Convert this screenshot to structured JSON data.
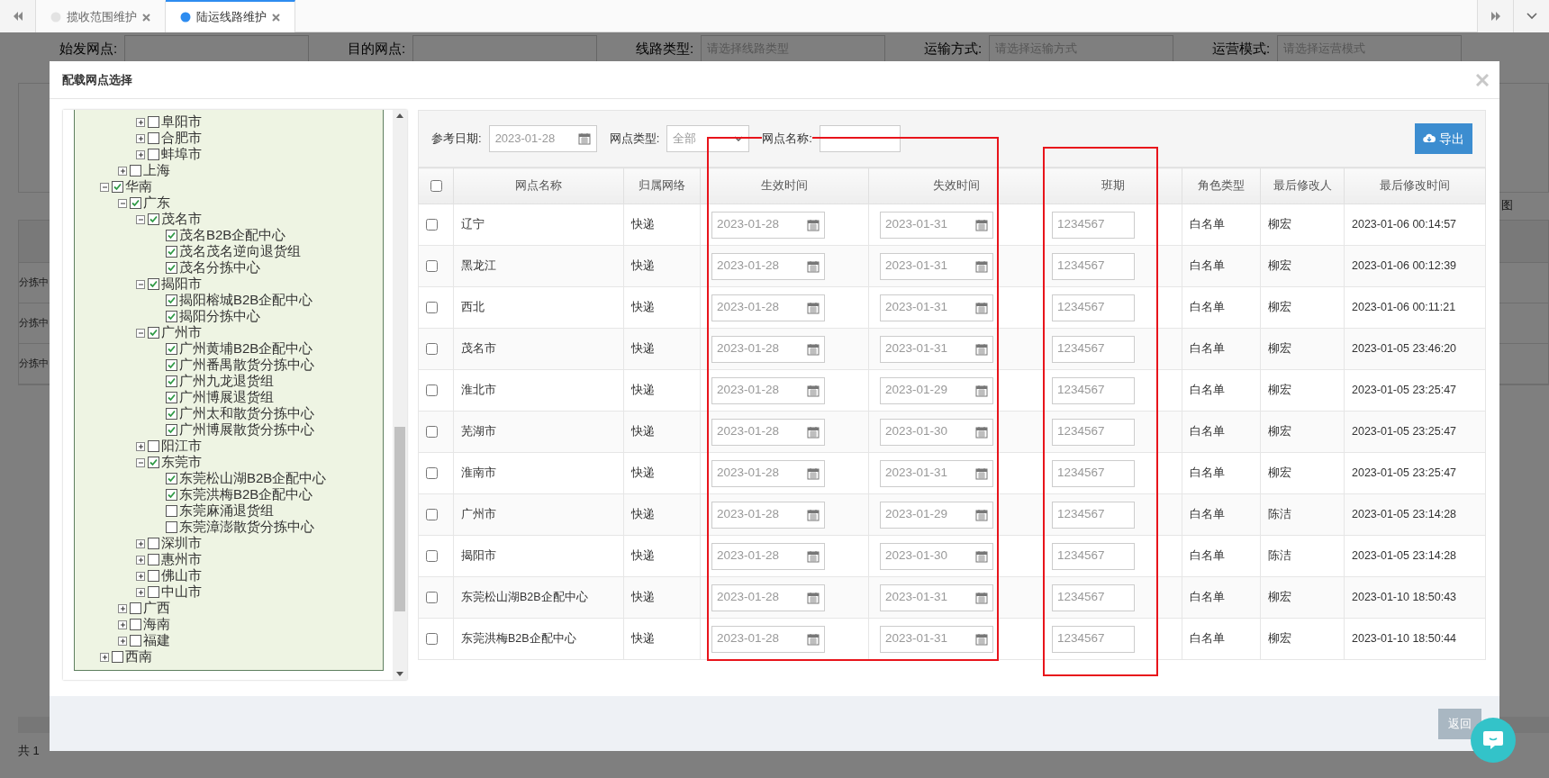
{
  "tabs": [
    {
      "label": "揽收范围维护",
      "selected": false
    },
    {
      "label": "陆运线路维护",
      "selected": true
    }
  ],
  "background": {
    "filters": [
      {
        "label": "始发网点:"
      },
      {
        "label": "目的网点:"
      },
      {
        "label": "线路类型:",
        "placeholder": "请选择线路类型"
      },
      {
        "label": "运输方式:",
        "placeholder": "请选择运输方式"
      },
      {
        "label": "运营模式:",
        "placeholder": "请选择运营模式"
      }
    ],
    "cells": [
      "分拣中",
      "分拣中",
      "分拣中"
    ],
    "side_text": "图",
    "pager": "共 1"
  },
  "dialog": {
    "title": "配载网点选择",
    "tree": [
      {
        "children": [
          {
            "children": [
              {
                "label": "阜阳市",
                "checked": false,
                "expanded": false
              },
              {
                "label": "合肥市",
                "checked": false,
                "expanded": false
              },
              {
                "label": "蚌埠市",
                "checked": false,
                "expanded": false
              }
            ]
          },
          {
            "label": "上海",
            "checked": false,
            "expanded": false
          }
        ]
      },
      {
        "label": "华南",
        "checked": true,
        "expanded": true,
        "children": [
          {
            "label": "广东",
            "checked": true,
            "expanded": true,
            "children": [
              {
                "label": "茂名市",
                "checked": true,
                "expanded": true,
                "children": [
                  {
                    "label": "茂名B2B企配中心",
                    "checked": true
                  },
                  {
                    "label": "茂名茂名逆向退货组",
                    "checked": true
                  },
                  {
                    "label": "茂名分拣中心",
                    "checked": true
                  }
                ]
              },
              {
                "label": "揭阳市",
                "checked": true,
                "expanded": true,
                "children": [
                  {
                    "label": "揭阳榕城B2B企配中心",
                    "checked": true
                  },
                  {
                    "label": "揭阳分拣中心",
                    "checked": true
                  }
                ]
              },
              {
                "label": "广州市",
                "checked": true,
                "expanded": true,
                "children": [
                  {
                    "label": "广州黄埔B2B企配中心",
                    "checked": true
                  },
                  {
                    "label": "广州番禺散货分拣中心",
                    "checked": true
                  },
                  {
                    "label": "广州九龙退货组",
                    "checked": true
                  },
                  {
                    "label": "广州博展退货组",
                    "checked": true
                  },
                  {
                    "label": "广州太和散货分拣中心",
                    "checked": true
                  },
                  {
                    "label": "广州博展散货分拣中心",
                    "checked": true
                  }
                ]
              },
              {
                "label": "阳江市",
                "checked": false,
                "expanded": false
              },
              {
                "label": "东莞市",
                "checked": true,
                "expanded": true,
                "children": [
                  {
                    "label": "东莞松山湖B2B企配中心",
                    "checked": true
                  },
                  {
                    "label": "东莞洪梅B2B企配中心",
                    "checked": true
                  },
                  {
                    "label": "东莞麻涌退货组",
                    "checked": false
                  },
                  {
                    "label": "东莞漳澎散货分拣中心",
                    "checked": false
                  }
                ]
              },
              {
                "label": "深圳市",
                "checked": false,
                "expanded": false
              },
              {
                "label": "惠州市",
                "checked": false,
                "expanded": false
              },
              {
                "label": "佛山市",
                "checked": false,
                "expanded": false
              },
              {
                "label": "中山市",
                "checked": false,
                "expanded": false
              }
            ]
          },
          {
            "label": "广西",
            "checked": false,
            "expanded": false
          },
          {
            "label": "海南",
            "checked": false,
            "expanded": false
          },
          {
            "label": "福建",
            "checked": false,
            "expanded": false
          }
        ]
      },
      {
        "label": "西南",
        "checked": false,
        "expanded": false
      }
    ],
    "filters": {
      "date_label": "参考日期:",
      "date": "2023-01-28",
      "type_label": "网点类型:",
      "type": "全部",
      "name_label": "网点名称:",
      "export": "导出"
    },
    "columns": [
      "网点名称",
      "归属网络",
      "生效时间",
      "失效时间",
      "班期",
      "角色类型",
      "最后修改人",
      "最后修改时间"
    ],
    "all_checked": false,
    "rows": [
      {
        "checked": false,
        "name": "辽宁",
        "network": "快递",
        "start": "2023-01-28",
        "end": "2023-01-31",
        "schedule": "1234567",
        "role": "白名单",
        "modifier": "柳宏",
        "modified": "2023-01-06 00:14:57"
      },
      {
        "checked": false,
        "name": "黑龙江",
        "network": "快递",
        "start": "2023-01-28",
        "end": "2023-01-31",
        "schedule": "1234567",
        "role": "白名单",
        "modifier": "柳宏",
        "modified": "2023-01-06 00:12:39"
      },
      {
        "checked": false,
        "name": "西北",
        "network": "快递",
        "start": "2023-01-28",
        "end": "2023-01-31",
        "schedule": "1234567",
        "role": "白名单",
        "modifier": "柳宏",
        "modified": "2023-01-06 00:11:21"
      },
      {
        "checked": false,
        "name": "茂名市",
        "network": "快递",
        "start": "2023-01-28",
        "end": "2023-01-31",
        "schedule": "1234567",
        "role": "白名单",
        "modifier": "柳宏",
        "modified": "2023-01-05 23:46:20"
      },
      {
        "checked": false,
        "name": "淮北市",
        "network": "快递",
        "start": "2023-01-28",
        "end": "2023-01-29",
        "schedule": "1234567",
        "role": "白名单",
        "modifier": "柳宏",
        "modified": "2023-01-05 23:25:47"
      },
      {
        "checked": false,
        "name": "芜湖市",
        "network": "快递",
        "start": "2023-01-28",
        "end": "2023-01-30",
        "schedule": "1234567",
        "role": "白名单",
        "modifier": "柳宏",
        "modified": "2023-01-05 23:25:47"
      },
      {
        "checked": false,
        "name": "淮南市",
        "network": "快递",
        "start": "2023-01-28",
        "end": "2023-01-31",
        "schedule": "1234567",
        "role": "白名单",
        "modifier": "柳宏",
        "modified": "2023-01-05 23:25:47"
      },
      {
        "checked": false,
        "name": "广州市",
        "network": "快递",
        "start": "2023-01-28",
        "end": "2023-01-29",
        "schedule": "1234567",
        "role": "白名单",
        "modifier": "陈洁",
        "modified": "2023-01-05 23:14:28"
      },
      {
        "checked": false,
        "name": "揭阳市",
        "network": "快递",
        "start": "2023-01-28",
        "end": "2023-01-30",
        "schedule": "1234567",
        "role": "白名单",
        "modifier": "陈洁",
        "modified": "2023-01-05 23:14:28"
      },
      {
        "checked": false,
        "name": "东莞松山湖B2B企配中心",
        "network": "快递",
        "start": "2023-01-28",
        "end": "2023-01-31",
        "schedule": "1234567",
        "role": "白名单",
        "modifier": "柳宏",
        "modified": "2023-01-10 18:50:43"
      },
      {
        "checked": false,
        "name": "东莞洪梅B2B企配中心",
        "network": "快递",
        "start": "2023-01-28",
        "end": "2023-01-31",
        "schedule": "1234567",
        "role": "白名单",
        "modifier": "柳宏",
        "modified": "2023-01-10 18:50:44"
      }
    ],
    "back_button": "返回"
  }
}
